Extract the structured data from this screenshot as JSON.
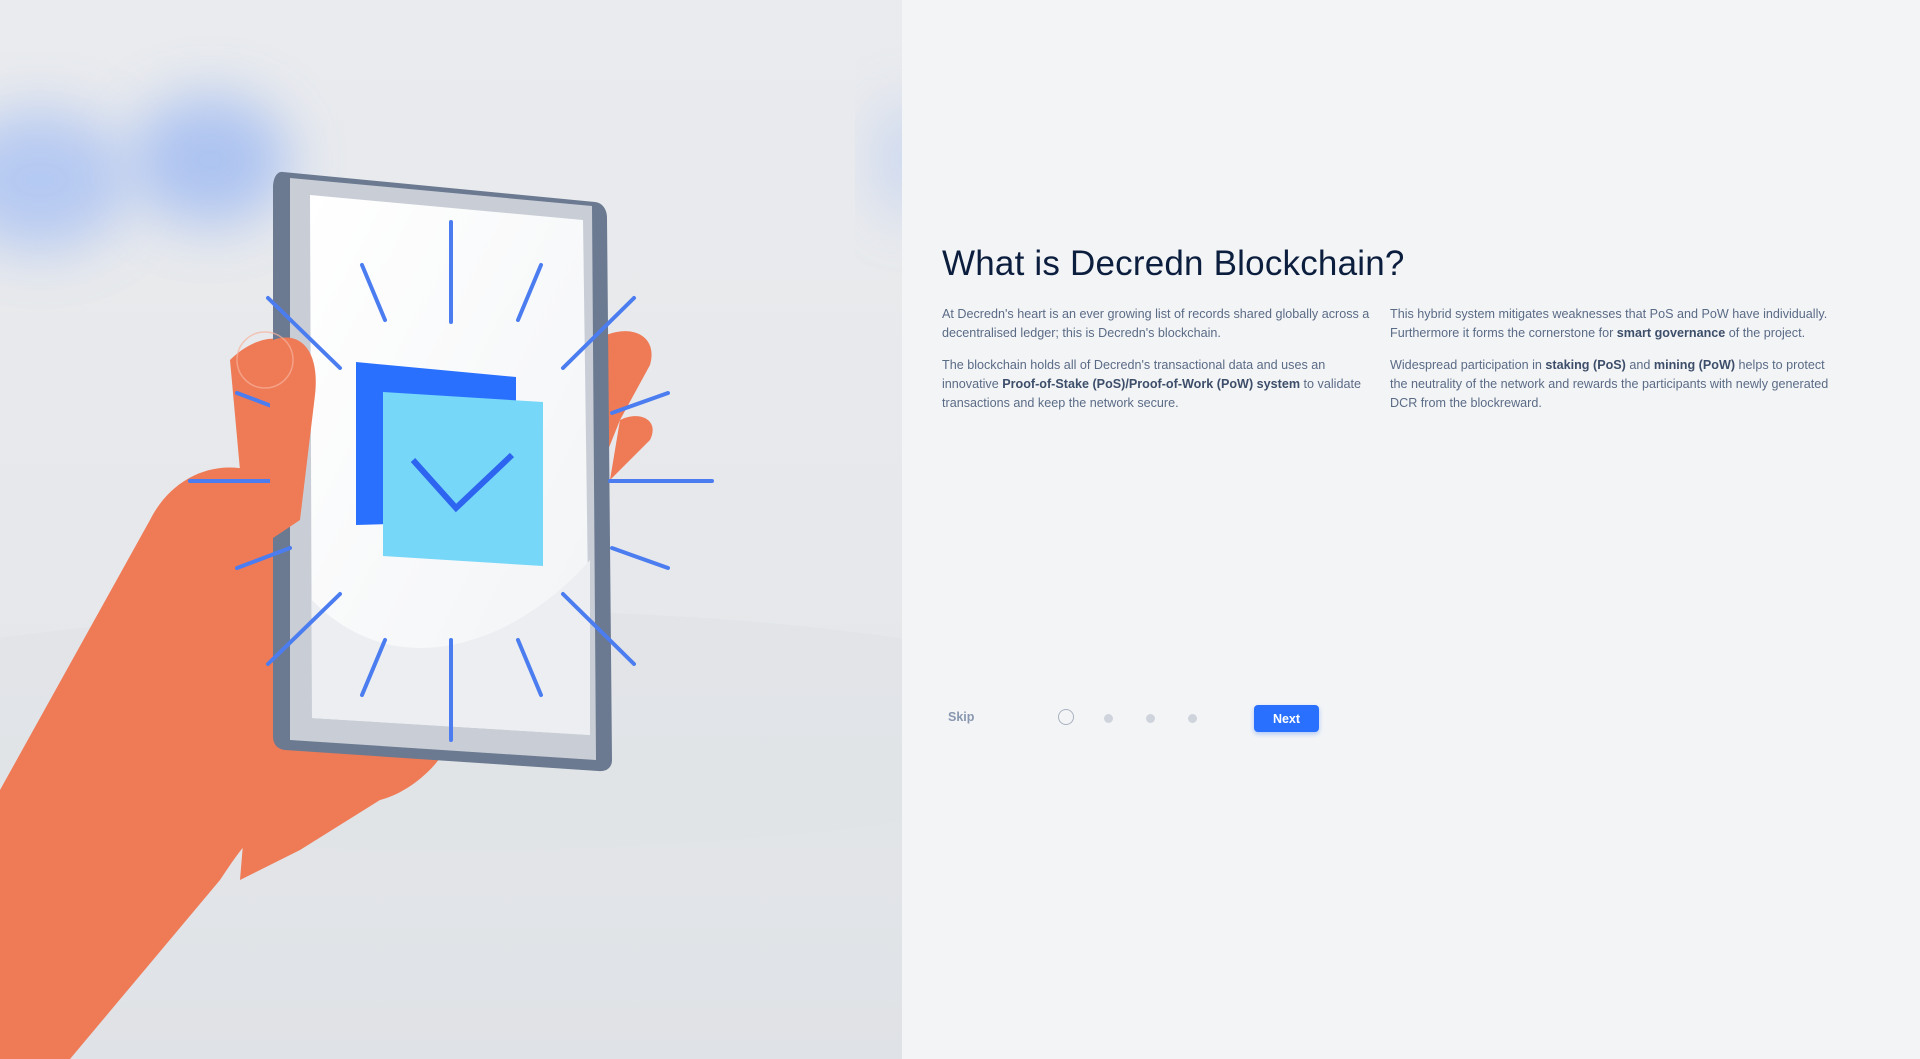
{
  "intro": {
    "title": "What is Decredn Blockchain?",
    "left_column": [
      [
        "At Decredn's heart is an ever growing list of records shared globally across a decentralised ledger; this is Decredn's blockchain."
      ],
      [
        "The blockchain holds all of Decredn's transactional data and uses an innovative ",
        "Proof-of-Stake (PoS)/Proof-of-Work (PoW) system",
        " to validate transactions and keep the network secure."
      ]
    ],
    "right_column": [
      [
        "This hybrid system mitigates weaknesses that PoS and PoW have individually. Furthermore it forms the cornerstone for ",
        "smart governance",
        " of the project."
      ],
      [
        "Widespread participation in ",
        "staking (PoS)",
        " and ",
        "mining (PoW)",
        " helps to protect the neutrality of the network and rewards the participants with newly generated DCR from the blockreward."
      ]
    ]
  },
  "footer": {
    "skip_label": "Skip",
    "next_label": "Next",
    "pagination": {
      "total": 4,
      "current": 1
    }
  },
  "illustration": {
    "subject": "hand holding phone with checkmark",
    "colors": {
      "hand": "#ef7a56",
      "phone_frame": "#6b7a91",
      "screen": "#ffffff",
      "accent_blue": "#2970ff",
      "light_blue": "#76d7f8",
      "rays": "#4b7df0"
    }
  },
  "colors": {
    "title": "#0c1e3e",
    "body_text": "#5a6b86",
    "button": "#2970ff",
    "background": "#f3f4f6"
  }
}
